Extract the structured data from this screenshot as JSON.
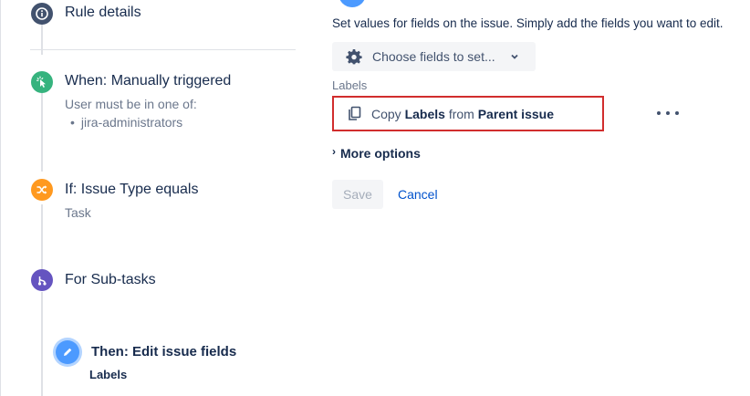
{
  "colors": {
    "rule_icon_bg": "#42526e",
    "trigger_icon_bg": "#36b37e",
    "condition_icon_bg": "#ff991f",
    "branch_icon_bg": "#6554c0",
    "action_icon_bg": "#4c9aff",
    "highlight_border": "#d12d2d",
    "link": "#0052cc"
  },
  "sidebar": {
    "rule_details": {
      "label": "Rule details",
      "icon": "info-icon"
    },
    "trigger": {
      "title": "When: Manually triggered",
      "subtitle": "User must be in one of:",
      "groups": [
        "jira-administrators"
      ],
      "icon": "cursor-click-icon"
    },
    "condition": {
      "title": "If: Issue Type equals",
      "subtitle": "Task",
      "icon": "shuffle-icon"
    },
    "branch": {
      "title": "For Sub-tasks",
      "icon": "branch-icon"
    },
    "action": {
      "title": "Then: Edit issue fields",
      "subtitle": "Labels",
      "icon": "pencil-icon"
    }
  },
  "editor": {
    "intro": "Set values for fields on the issue. Simply add the fields you want to edit.",
    "choose_fields_label": "Choose fields to set...",
    "field_label": "Labels",
    "copy_row": {
      "prefix": "Copy",
      "field": "Labels",
      "middle": "from",
      "source": "Parent issue"
    },
    "more_options_label": "More options",
    "save_label": "Save",
    "cancel_label": "Cancel"
  }
}
